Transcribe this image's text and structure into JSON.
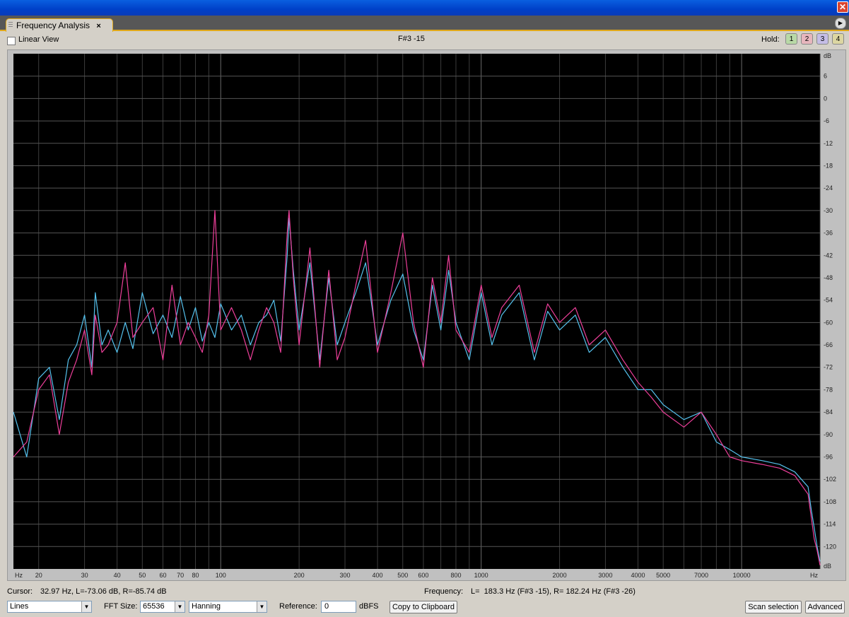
{
  "window": {
    "close_glyph": "✕"
  },
  "tab": {
    "title": "Frequency Analysis",
    "close": "×"
  },
  "toolbar": {
    "linear_view_label": "Linear View",
    "note_display": "F#3 -15",
    "hold_label": "Hold:",
    "hold_buttons": [
      {
        "label": "1",
        "color": "#b9d9a6"
      },
      {
        "label": "2",
        "color": "#e7b6bd"
      },
      {
        "label": "3",
        "color": "#c5bde6"
      },
      {
        "label": "4",
        "color": "#dcd6a2"
      }
    ]
  },
  "status": {
    "cursor_label": "Cursor:",
    "cursor_value": "32.97 Hz, L=-73.06 dB, R=-85.74 dB",
    "frequency_label": "Frequency:",
    "frequency_value": "L=  183.3 Hz (F#3 -15), R= 182.24 Hz (F#3 -26)"
  },
  "controls": {
    "display_mode": "Lines",
    "fft_label": "FFT Size:",
    "fft_size": "65536",
    "window_func": "Hanning",
    "reference_label": "Reference:",
    "reference_value": "0",
    "reference_unit": "dBFS",
    "copy_button": "Copy to Clipboard",
    "scan_button": "Scan selection",
    "advanced_button": "Advanced"
  },
  "chart_data": {
    "type": "line",
    "x_scale": "log",
    "xlim": [
      16,
      20000
    ],
    "ylim": [
      -126,
      12
    ],
    "x_ticks": [
      20,
      30,
      40,
      50,
      60,
      70,
      80,
      100,
      200,
      300,
      400,
      500,
      600,
      800,
      1000,
      2000,
      3000,
      4000,
      5000,
      7000,
      10000
    ],
    "x_tick_labels": [
      "20",
      "30",
      "40",
      "50",
      "60",
      "70",
      "80",
      "100",
      "200",
      "300",
      "400",
      "500",
      "600",
      "800",
      "1000",
      "2000",
      "3000",
      "4000",
      "5000",
      "7000",
      "10000"
    ],
    "x_unit_left": "Hz",
    "x_unit_right": "Hz",
    "y_ticks": [
      6,
      0,
      -6,
      -12,
      -18,
      -24,
      -30,
      -36,
      -42,
      -48,
      -54,
      -60,
      -66,
      -72,
      -78,
      -84,
      -90,
      -96,
      -102,
      -108,
      -114,
      -120
    ],
    "y_tick_labels": [
      "6",
      "0",
      "-6",
      "-12",
      "-18",
      "-24",
      "-30",
      "-36",
      "-42",
      "-48",
      "-54",
      "-60",
      "-66",
      "-72",
      "-78",
      "-84",
      "-90",
      "-96",
      "-102",
      "-108",
      "-114",
      "-120"
    ],
    "y_unit_top": "dB",
    "y_unit_bottom": "dB",
    "grid": true,
    "background": "#000000",
    "grid_color": "#555555",
    "series": [
      {
        "color": "#55c2ee",
        "x": [
          16,
          18,
          20,
          22,
          24,
          26,
          28,
          30,
          32,
          33,
          35,
          37,
          40,
          43,
          46,
          50,
          55,
          60,
          65,
          70,
          75,
          80,
          85,
          90,
          95,
          100,
          110,
          120,
          130,
          140,
          150,
          160,
          170,
          180,
          183,
          190,
          200,
          220,
          240,
          260,
          280,
          300,
          330,
          360,
          400,
          450,
          500,
          550,
          600,
          650,
          700,
          750,
          800,
          900,
          1000,
          1100,
          1200,
          1400,
          1600,
          1800,
          2000,
          2300,
          2600,
          3000,
          3500,
          4000,
          4500,
          5000,
          6000,
          7000,
          8000,
          9000,
          10000,
          12000,
          14000,
          16000,
          18000,
          18500,
          19000,
          19500,
          20000
        ],
        "y": [
          -84,
          -96,
          -75,
          -72,
          -86,
          -70,
          -66,
          -58,
          -72,
          -52,
          -66,
          -62,
          -68,
          -60,
          -67,
          -52,
          -63,
          -58,
          -64,
          -53,
          -62,
          -56,
          -65,
          -60,
          -64,
          -55,
          -62,
          -58,
          -66,
          -60,
          -58,
          -54,
          -65,
          -42,
          -32,
          -46,
          -62,
          -44,
          -70,
          -48,
          -66,
          -60,
          -52,
          -44,
          -66,
          -54,
          -47,
          -62,
          -70,
          -50,
          -62,
          -46,
          -60,
          -70,
          -52,
          -66,
          -58,
          -52,
          -70,
          -57,
          -62,
          -58,
          -68,
          -64,
          -72,
          -78,
          -78,
          -82,
          -86,
          -84,
          -92,
          -94,
          -96,
          -97,
          -98,
          -100,
          -104,
          -110,
          -115,
          -120,
          -124
        ]
      },
      {
        "color": "#ee3f9a",
        "x": [
          16,
          18,
          20,
          22,
          24,
          26,
          28,
          30,
          32,
          33,
          35,
          37,
          40,
          43,
          46,
          50,
          55,
          60,
          65,
          70,
          75,
          80,
          85,
          90,
          95,
          100,
          110,
          120,
          130,
          140,
          150,
          160,
          170,
          180,
          183,
          190,
          200,
          220,
          240,
          260,
          280,
          300,
          330,
          360,
          400,
          450,
          500,
          550,
          600,
          650,
          700,
          750,
          800,
          900,
          1000,
          1100,
          1200,
          1400,
          1600,
          1800,
          2000,
          2300,
          2600,
          3000,
          3500,
          4000,
          4500,
          5000,
          6000,
          7000,
          8000,
          9000,
          10000,
          12000,
          14000,
          16000,
          18000,
          18500,
          19000,
          19500,
          20000
        ],
        "y": [
          -96,
          -92,
          -78,
          -74,
          -90,
          -76,
          -70,
          -62,
          -74,
          -58,
          -68,
          -66,
          -60,
          -44,
          -64,
          -60,
          -56,
          -70,
          -50,
          -66,
          -60,
          -64,
          -68,
          -58,
          -30,
          -62,
          -56,
          -62,
          -70,
          -62,
          -56,
          -60,
          -68,
          -36,
          -30,
          -48,
          -66,
          -40,
          -72,
          -46,
          -70,
          -64,
          -50,
          -38,
          -68,
          -52,
          -36,
          -60,
          -72,
          -48,
          -60,
          -42,
          -62,
          -68,
          -50,
          -64,
          -56,
          -50,
          -68,
          -55,
          -60,
          -56,
          -66,
          -62,
          -70,
          -76,
          -80,
          -84,
          -88,
          -84,
          -90,
          -96,
          -97,
          -98,
          -99,
          -101,
          -106,
          -112,
          -118,
          -121,
          -125
        ]
      }
    ]
  }
}
